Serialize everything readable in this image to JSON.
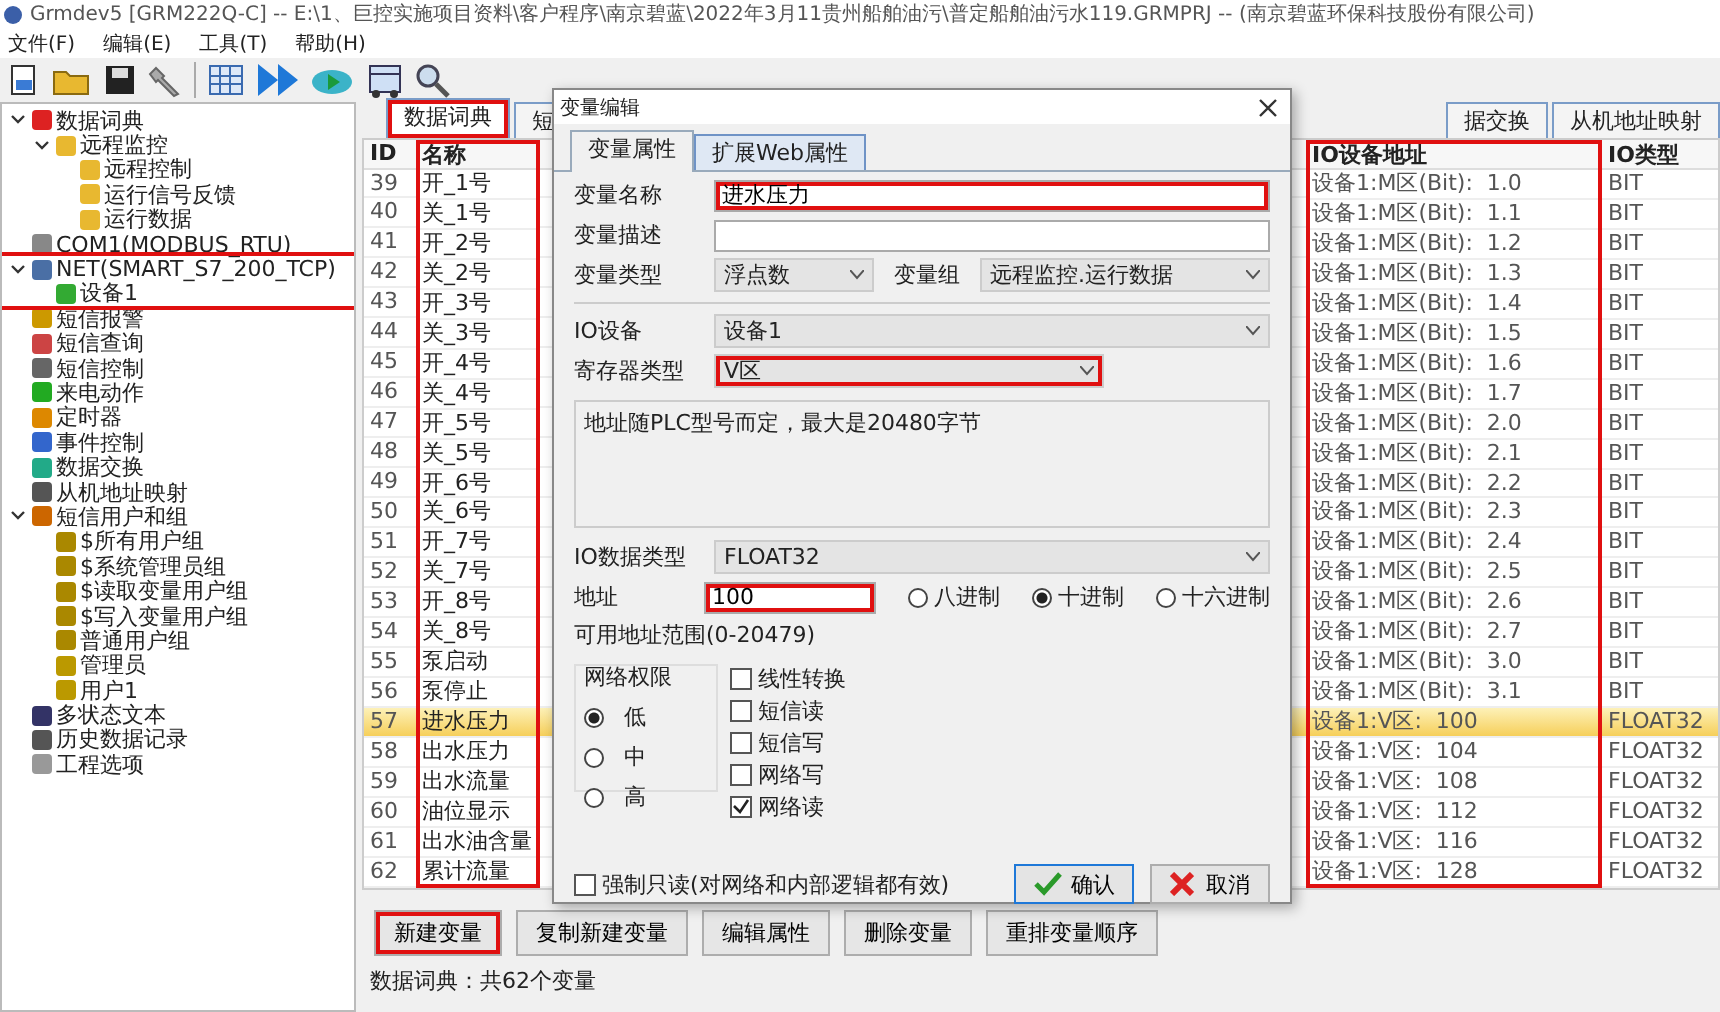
{
  "window": {
    "title": "Grmdev5 [GRM222Q-C] -- E:\\1、巨控实施项目资料\\客户程序\\南京碧蓝\\2022年3月11贵州船舶油污\\普定船舶油污水119.GRMPRJ -- (南京碧蓝环保科技股份有限公司)"
  },
  "menu": [
    "文件(F)",
    "编辑(E)",
    "工具(T)",
    "帮助(H)"
  ],
  "sidebar": {
    "tree": [
      {
        "label": "数据词典",
        "kind": "book",
        "expanded": true,
        "children": [
          {
            "label": "远程监控",
            "kind": "folder",
            "expanded": true,
            "children": [
              {
                "label": "远程控制",
                "kind": "folder"
              },
              {
                "label": "运行信号反馈",
                "kind": "folder"
              },
              {
                "label": "运行数据",
                "kind": "folder"
              }
            ]
          }
        ]
      },
      {
        "label": "COM1(MODBUS_RTU)",
        "kind": "port"
      },
      {
        "label": "NET(SMART_S7_200_TCP)",
        "kind": "network",
        "expanded": true,
        "highlighted": true,
        "children": [
          {
            "label": "设备1",
            "kind": "device"
          }
        ]
      },
      {
        "label": "短信报警",
        "kind": "bell"
      },
      {
        "label": "短信查询",
        "kind": "query"
      },
      {
        "label": "短信控制",
        "kind": "message"
      },
      {
        "label": "来电动作",
        "kind": "phone"
      },
      {
        "label": "定时器",
        "kind": "clock"
      },
      {
        "label": "事件控制",
        "kind": "event"
      },
      {
        "label": "数据交换",
        "kind": "exchange"
      },
      {
        "label": "从机地址映射",
        "kind": "address"
      },
      {
        "label": "短信用户和组",
        "kind": "users",
        "expanded": true,
        "children": [
          {
            "label": "$所有用户组",
            "kind": "group"
          },
          {
            "label": "$系统管理员组",
            "kind": "group"
          },
          {
            "label": "$读取变量用户组",
            "kind": "group"
          },
          {
            "label": "$写入变量用户组",
            "kind": "group"
          },
          {
            "label": "普通用户组",
            "kind": "group"
          },
          {
            "label": "管理员",
            "kind": "user"
          },
          {
            "label": "用户1",
            "kind": "user"
          }
        ]
      },
      {
        "label": "多状态文本",
        "kind": "text"
      },
      {
        "label": "历史数据记录",
        "kind": "history"
      },
      {
        "label": "工程选项",
        "kind": "wrench"
      }
    ]
  },
  "tabs": [
    {
      "label": "数据词典",
      "selected": true,
      "highlighted": true
    },
    {
      "label": "短",
      "selected": false
    },
    {
      "label": "据交换",
      "selected": false
    },
    {
      "label": "从机地址映射",
      "selected": false
    }
  ],
  "table": {
    "columns": [
      {
        "title": "ID",
        "highlighted": false
      },
      {
        "title": "名称",
        "highlighted": true
      },
      {
        "title": "IO设备地址",
        "highlighted": true
      },
      {
        "title": "IO类型",
        "highlighted": false
      }
    ],
    "rows": [
      {
        "cells": [
          "39",
          "开_1号",
          "设备1:M区(Bit):  1.0",
          "BIT"
        ],
        "selected": false
      },
      {
        "cells": [
          "40",
          "关_1号",
          "设备1:M区(Bit):  1.1",
          "BIT"
        ],
        "selected": false
      },
      {
        "cells": [
          "41",
          "开_2号",
          "设备1:M区(Bit):  1.2",
          "BIT"
        ],
        "selected": false
      },
      {
        "cells": [
          "42",
          "关_2号",
          "设备1:M区(Bit):  1.3",
          "BIT"
        ],
        "selected": false
      },
      {
        "cells": [
          "43",
          "开_3号",
          "设备1:M区(Bit):  1.4",
          "BIT"
        ],
        "selected": false
      },
      {
        "cells": [
          "44",
          "关_3号",
          "设备1:M区(Bit):  1.5",
          "BIT"
        ],
        "selected": false
      },
      {
        "cells": [
          "45",
          "开_4号",
          "设备1:M区(Bit):  1.6",
          "BIT"
        ],
        "selected": false
      },
      {
        "cells": [
          "46",
          "关_4号",
          "设备1:M区(Bit):  1.7",
          "BIT"
        ],
        "selected": false
      },
      {
        "cells": [
          "47",
          "开_5号",
          "设备1:M区(Bit):  2.0",
          "BIT"
        ],
        "selected": false
      },
      {
        "cells": [
          "48",
          "关_5号",
          "设备1:M区(Bit):  2.1",
          "BIT"
        ],
        "selected": false
      },
      {
        "cells": [
          "49",
          "开_6号",
          "设备1:M区(Bit):  2.2",
          "BIT"
        ],
        "selected": false
      },
      {
        "cells": [
          "50",
          "关_6号",
          "设备1:M区(Bit):  2.3",
          "BIT"
        ],
        "selected": false
      },
      {
        "cells": [
          "51",
          "开_7号",
          "设备1:M区(Bit):  2.4",
          "BIT"
        ],
        "selected": false
      },
      {
        "cells": [
          "52",
          "关_7号",
          "设备1:M区(Bit):  2.5",
          "BIT"
        ],
        "selected": false
      },
      {
        "cells": [
          "53",
          "开_8号",
          "设备1:M区(Bit):  2.6",
          "BIT"
        ],
        "selected": false
      },
      {
        "cells": [
          "54",
          "关_8号",
          "设备1:M区(Bit):  2.7",
          "BIT"
        ],
        "selected": false
      },
      {
        "cells": [
          "55",
          "泵启动",
          "设备1:M区(Bit):  3.0",
          "BIT"
        ],
        "selected": false
      },
      {
        "cells": [
          "56",
          "泵停止",
          "设备1:M区(Bit):  3.1",
          "BIT"
        ],
        "selected": false
      },
      {
        "cells": [
          "57",
          "进水压力",
          "设备1:V区:  100",
          "FLOAT32"
        ],
        "selected": true
      },
      {
        "cells": [
          "58",
          "出水压力",
          "设备1:V区:  104",
          "FLOAT32"
        ],
        "selected": false
      },
      {
        "cells": [
          "59",
          "出水流量",
          "设备1:V区:  108",
          "FLOAT32"
        ],
        "selected": false
      },
      {
        "cells": [
          "60",
          "油位显示",
          "设备1:V区:  112",
          "FLOAT32"
        ],
        "selected": false
      },
      {
        "cells": [
          "61",
          "出水油含量",
          "设备1:V区:  116",
          "FLOAT32"
        ],
        "selected": false
      },
      {
        "cells": [
          "62",
          "累计流量",
          "设备1:V区:  128",
          "FLOAT32"
        ],
        "selected": false
      }
    ]
  },
  "buttons": [
    {
      "label": "新建变量",
      "highlighted": true
    },
    {
      "label": "复制新建变量",
      "highlighted": false
    },
    {
      "label": "编辑属性",
      "highlighted": false
    },
    {
      "label": "删除变量",
      "highlighted": false
    },
    {
      "label": "重排变量顺序",
      "highlighted": false
    }
  ],
  "status_bar": "数据词典：共62个变量",
  "dialog": {
    "title": "变量编辑",
    "tabs": [
      {
        "label": "变量属性",
        "selected": true
      },
      {
        "label": "扩展Web属性",
        "selected": false
      }
    ],
    "name": {
      "label": "变量名称",
      "value": "进水压力",
      "highlighted": true
    },
    "description": {
      "label": "变量描述"
    },
    "var_type": {
      "label": "变量类型",
      "value": "浮点数"
    },
    "var_group": {
      "label": "变量组",
      "value": "远程监控.运行数据"
    },
    "io_device": {
      "label": "IO设备",
      "value": "设备1"
    },
    "register_type": {
      "label": "寄存器类型",
      "value": "V区",
      "highlighted": true
    },
    "note": "地址随PLC型号而定，最大是20480字节",
    "data_type": {
      "label": "IO数据类型",
      "value": "FLOAT32"
    },
    "address": {
      "label": "地址",
      "value": "100",
      "highlighted": true
    },
    "bases": [
      {
        "label": "八进制",
        "selected": false
      },
      {
        "label": "十进制",
        "selected": true
      },
      {
        "label": "十六进制",
        "selected": false
      }
    ],
    "range": "可用地址范围(0-20479)",
    "permission": {
      "title": "网络权限",
      "options": [
        {
          "label": "低",
          "selected": true
        },
        {
          "label": "中",
          "selected": false
        },
        {
          "label": "高",
          "selected": false
        }
      ]
    },
    "flags": [
      {
        "label": "线性转换",
        "checked": false
      },
      {
        "label": "短信读",
        "checked": false
      },
      {
        "label": "短信写",
        "checked": false
      },
      {
        "label": "网络写",
        "checked": false
      },
      {
        "label": "网络读",
        "checked": true
      }
    ],
    "force_readonly": {
      "label": "强制只读(对网络和内部逻辑都有效)",
      "checked": false
    },
    "buttons": [
      {
        "label": "确认",
        "kind": "confirm"
      },
      {
        "label": "取消",
        "kind": "cancel"
      }
    ]
  }
}
